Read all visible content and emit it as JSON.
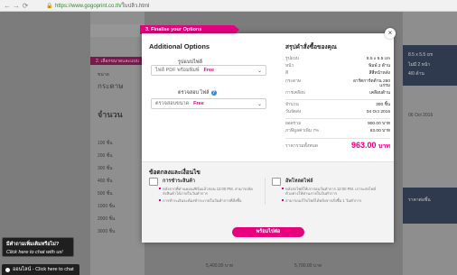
{
  "browser": {
    "url_host": "https://www.gogoprint.co.th",
    "url_path": "/ใบปลิว.html"
  },
  "background": {
    "stepbar": "2. เลือกขนาดและแบบ",
    "left_labels": [
      "ขนาด",
      "กระดาษ",
      "จำนวน",
      "100 ชิ้น",
      "200 ชิ้น",
      "300 ชิ้น",
      "400 ชิ้น",
      "500 ชิ้น",
      "1000 ชิ้น",
      "2000 ชิ้น",
      "3000 ชิ้น"
    ],
    "right_values": [
      "8.5 x 5.5 cm",
      "ไม่มี 2 หน้า",
      "4/0 ด้าน",
      "06 Oct 2016",
      "ราคาต่อชิ้น"
    ],
    "bottom_prices": [
      "5,400.00 บาท",
      "5,700.00 บาท"
    ]
  },
  "chat": {
    "title": "มีคำถามเพิ่มเติมหรือไม่?",
    "subtitle": "Click here to chat with us!",
    "bar_label": "ออนไลน์ - Click here to chat"
  },
  "modal": {
    "tab_label": "3. Finalise your Options",
    "close_label": "×",
    "title": "Additional Options",
    "field1": {
      "label": "รูปแบบไฟล์",
      "value": "ไฟล์ PDF พร้อมพิมพ์",
      "price": "Free"
    },
    "field2": {
      "label": "ตรวจสอบ ไฟล์",
      "value": "ตรวจสอบขนาด",
      "price": "Free"
    },
    "summary": {
      "title": "สรุปคำสั่งซื้อของคุณ",
      "rows": [
        {
          "k": "รูปแบบ",
          "v": "8.5 x 5.5 cm"
        },
        {
          "k": "หน้า",
          "v": "พิมพ์ 2 ด้าน"
        },
        {
          "k": "สี",
          "v": "สีสี่หน้าหลัง"
        },
        {
          "k": "กระดาษ",
          "v": "อาร์ตการ์ดด้าน 260 แกรม"
        },
        {
          "k": "การเคลือบ",
          "v": "เคลือบด้าน"
        }
      ],
      "rows2": [
        {
          "k": "จำนวน",
          "v": "300 ชิ้น"
        },
        {
          "k": "วันจัดส่ง",
          "v": "04 Oct 2016"
        }
      ],
      "rows3": [
        {
          "k": "ยอดรวม",
          "v": "900.00 บาท"
        },
        {
          "k": "ภาษีมูลค่าเพิ่ม 7%",
          "v": "63.00 บาท"
        }
      ],
      "total_label": "ราคารวมทั้งหมด",
      "total_value": "963.00",
      "total_unit": "บาท"
    },
    "bottom": {
      "title": "ข้อตกลงและเงื่อนไข",
      "col1": {
        "title": "การชำระสินค้า",
        "b1": "หลังจากที่ท่านคอนเฟิร์มแล้วก่อน 12:00 PM. สามารถจัดส่งสินค้าได้ภายในวันทำการ",
        "b2": "การชำระเงินจะต้องชำระภายในวันทำการที่สั่งซื้อ"
      },
      "col2": {
        "title": "อัพโหลดไฟล์",
        "b1": "หลังส่งไฟล์ให้เราก่อนวันทำการ 12:00 PM. เราจะส่งไฟล์ตัวอย่างให้ท่านภายในวันทำการ",
        "b2": "สามารถแก้ไขไฟล์ได้หลังจากสั่งซื้อ 1 วันทำการ"
      },
      "button": "พร้อมไปต่อ"
    }
  }
}
